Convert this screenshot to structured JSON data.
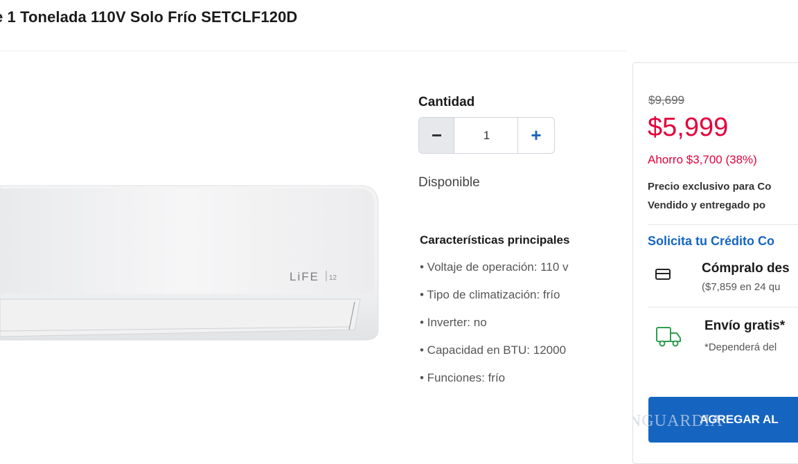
{
  "product": {
    "title": "e 1 Tonelada 110V Solo Frío SETCLF120D",
    "image_brand": "LiFE",
    "image_badge": "12"
  },
  "purchase": {
    "quantity_label": "Cantidad",
    "quantity_value": "1",
    "decrement_label": "−",
    "increment_label": "+",
    "availability": "Disponible"
  },
  "features": {
    "title": "Características principales",
    "items": [
      "• Voltaje de operación: 110 v",
      "• Tipo de climatización: frío",
      "• Inverter: no",
      "• Capacidad en BTU: 12000",
      "• Funciones: frío"
    ]
  },
  "price_card": {
    "old_price": "$9,699",
    "new_price": "$5,999",
    "savings": "Ahorro $3,700 (38%)",
    "exclusive": "Precio exclusivo para Co",
    "sold_by": "Vendido y entregado po",
    "credit_link": "Solicita tu Crédito Co",
    "buy_title": "Cómpralo des",
    "buy_sub": "($7,859 en 24 qu",
    "ship_title": "Envío gratis*",
    "ship_sub": "*Dependerá del",
    "add_button": "AGREGAR AL",
    "watermark": "NGUARDIA"
  },
  "colors": {
    "price_red": "#e4003a",
    "accent_blue": "#1565c0"
  },
  "icons": {
    "credit": "credit-card-icon",
    "shipping": "truck-icon"
  }
}
